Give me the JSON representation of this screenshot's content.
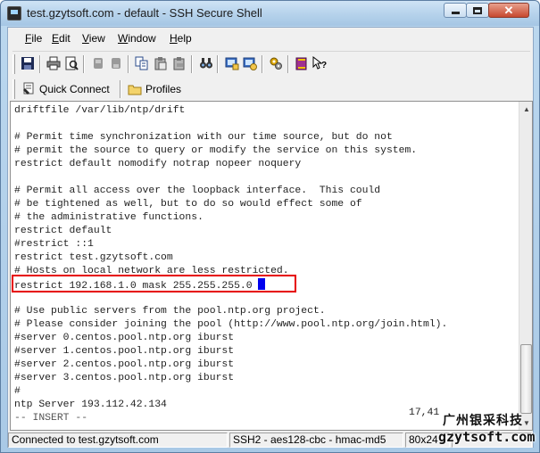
{
  "window": {
    "title": "test.gzytsoft.com - default - SSH Secure Shell",
    "close_glyph": "✕"
  },
  "menu": {
    "items": [
      {
        "accel": "F",
        "rest": "ile"
      },
      {
        "accel": "E",
        "rest": "dit"
      },
      {
        "accel": "V",
        "rest": "iew"
      },
      {
        "accel": "W",
        "rest": "indow"
      },
      {
        "accel": "H",
        "rest": "elp"
      }
    ]
  },
  "toolbar": {
    "icons": [
      "save-icon",
      "print-icon",
      "print-preview-icon",
      "disconnect-icon",
      "connect-icon",
      "copy-icon",
      "paste-icon",
      "paste-special-icon",
      "find-icon",
      "profiles-icon",
      "settings-icon",
      "tools-icon",
      "help-topics-icon",
      "whats-this-icon"
    ]
  },
  "linkbar": {
    "quick_connect": "Quick Connect",
    "profiles": "Profiles"
  },
  "terminal": {
    "lines": [
      "driftfile /var/lib/ntp/drift",
      "",
      "# Permit time synchronization with our time source, but do not",
      "# permit the source to query or modify the service on this system.",
      "restrict default nomodify notrap nopeer noquery",
      "",
      "# Permit all access over the loopback interface.  This could",
      "# be tightened as well, but to do so would effect some of",
      "# the administrative functions.",
      "restrict default",
      "#restrict ::1",
      "restrict test.gzytsoft.com",
      "# Hosts on local network are less restricted.",
      "restrict 192.168.1.0 mask 255.255.255.0 ",
      "",
      "# Use public servers from the pool.ntp.org project.",
      "# Please consider joining the pool (http://www.pool.ntp.org/join.html).",
      "#server 0.centos.pool.ntp.org iburst",
      "#server 1.centos.pool.ntp.org iburst",
      "#server 2.centos.pool.ntp.org iburst",
      "#server 3.centos.pool.ntp.org iburst",
      "#",
      "ntp Server 193.112.42.134",
      "-- INSERT --"
    ],
    "cursor_line": 13,
    "position": "17,41"
  },
  "status": {
    "connection": "Connected to test.gzytsoft.com",
    "cipher": "SSH2 - aes128-cbc - hmac-md5",
    "size": "80x24"
  },
  "watermark": {
    "cn": "广州银采科技",
    "en": "gzytsoft.com"
  }
}
